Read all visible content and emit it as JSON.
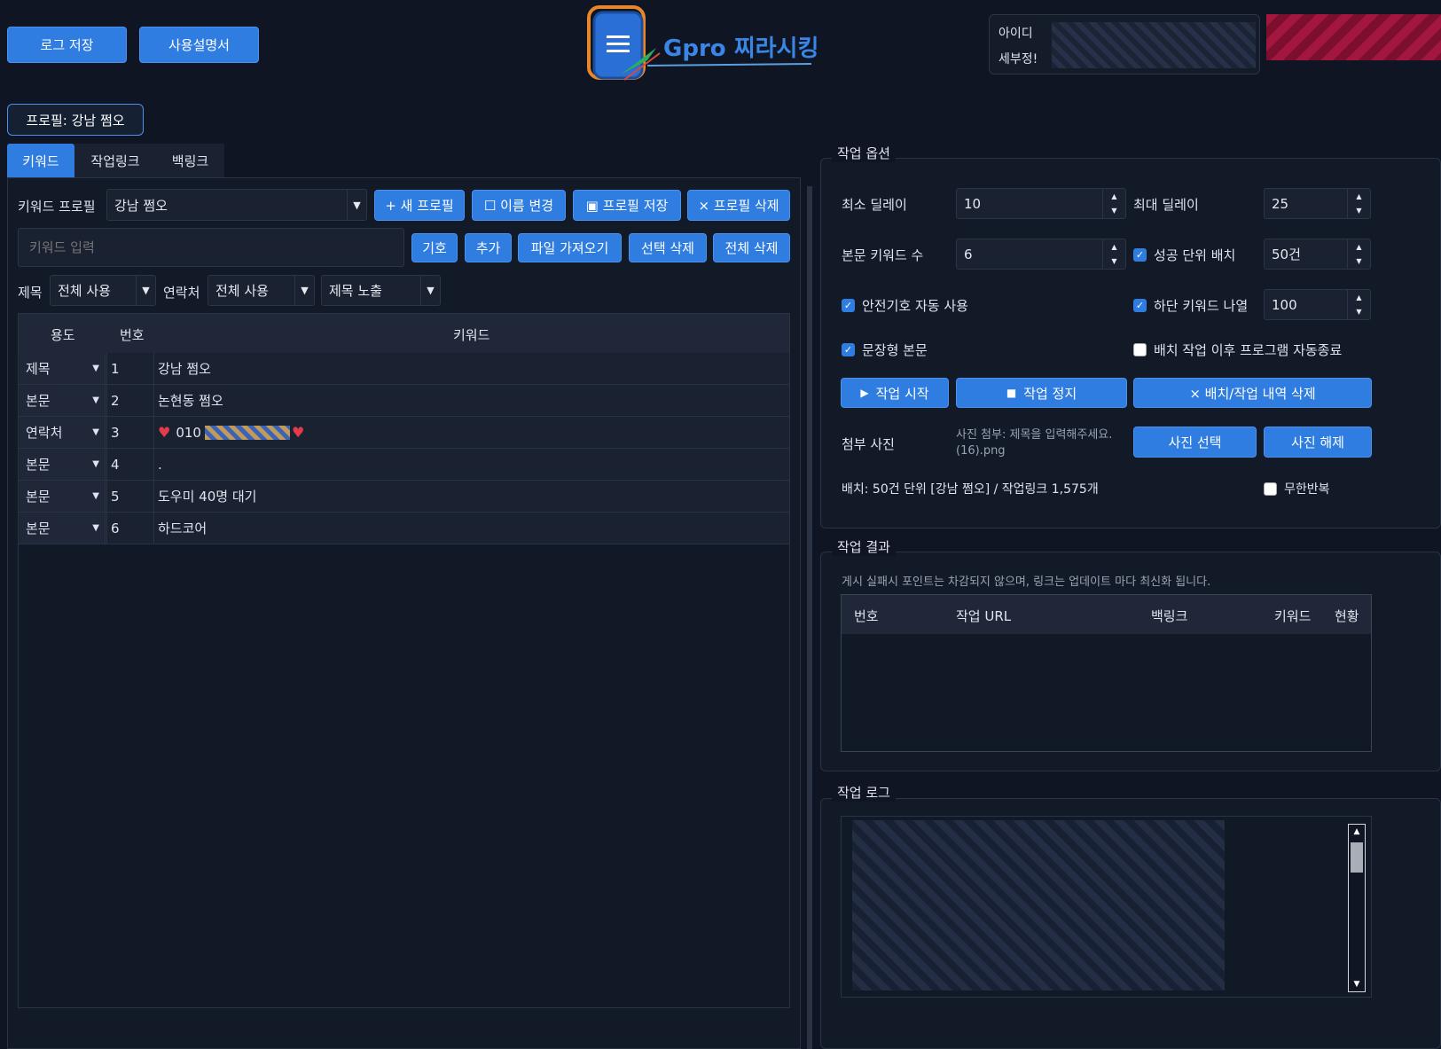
{
  "top": {
    "log_save": "로그 저장",
    "manual": "사용설명서",
    "logo_text": "Gpro 찌라시킹",
    "id_label": "아이디",
    "detail_label": "세부정!",
    "profile_badge": "프로필: 강남 쩜오"
  },
  "tabs": [
    "키워드",
    "작업링크",
    "백링크"
  ],
  "keyword_panel": {
    "profile_label": "키워드 프로필",
    "profile_value": "강남 쩜오",
    "new_profile": "+ 새 프로필",
    "rename": "☐ 이름 변경",
    "save_profile": "▣ 프로필 저장",
    "delete_profile": "× 프로필 삭제",
    "input_placeholder": "키워드 입력",
    "symbol": "기호",
    "add": "추가",
    "import_file": "파일 가져오기",
    "delete_selected": "선택 삭제",
    "delete_all": "전체 삭제",
    "title_label": "제목",
    "title_value": "전체 사용",
    "contact_label": "연락처",
    "contact_value": "전체 사용",
    "exposure_value": "제목 노출",
    "columns": [
      "용도",
      "번호",
      "키워드"
    ],
    "rows": [
      {
        "use": "제목",
        "num": "1",
        "keyword": "강남 쩜오"
      },
      {
        "use": "본문",
        "num": "2",
        "keyword": "논현동 쩜오"
      },
      {
        "use": "연락처",
        "num": "3",
        "keyword": "010"
      },
      {
        "use": "본문",
        "num": "4",
        "keyword": "."
      },
      {
        "use": "본문",
        "num": "5",
        "keyword": "도우미 40명 대기"
      },
      {
        "use": "본문",
        "num": "6",
        "keyword": "하드코어"
      }
    ]
  },
  "options": {
    "title": "작업 옵션",
    "min_delay_label": "최소 딜레이",
    "min_delay": "10",
    "max_delay_label": "최대 딜레이",
    "max_delay": "25",
    "body_kw_label": "본문 키워드 수",
    "body_kw": "6",
    "success_batch_label": "성공 단위 배치",
    "success_batch": "50건",
    "safe_symbol_label": "안전기호 자동 사용",
    "bottom_kw_label": "하단 키워드 나열",
    "bottom_kw": "100",
    "sentence_body_label": "문장형 본문",
    "auto_exit_label": "배치 작업 이후 프로그램 자동종료",
    "start": "작업 시작",
    "stop": "작업 정지",
    "clear_history": "× 배치/작업 내역 삭제",
    "attach_label": "첨부 사진",
    "attach_info": "사진 첨부: 제목을 입력해주세요. (16).png",
    "photo_select": "사진 선택",
    "photo_clear": "사진 해제",
    "batch_info": "배치: 50건 단위 [강남 쩜오] / 작업링크 1,575개",
    "infinite_label": "무한반복"
  },
  "results": {
    "title": "작업 결과",
    "note": "게시 실패시 포인트는 차감되지 않으며, 링크는 업데이트 마다 최신화 됩니다.",
    "columns": [
      "번호",
      "작업 URL",
      "백링크",
      "키워드",
      "현황"
    ]
  },
  "log": {
    "title": "작업 로그"
  },
  "colors": {
    "accent": "#2f7de1",
    "background": "#0f1522"
  }
}
